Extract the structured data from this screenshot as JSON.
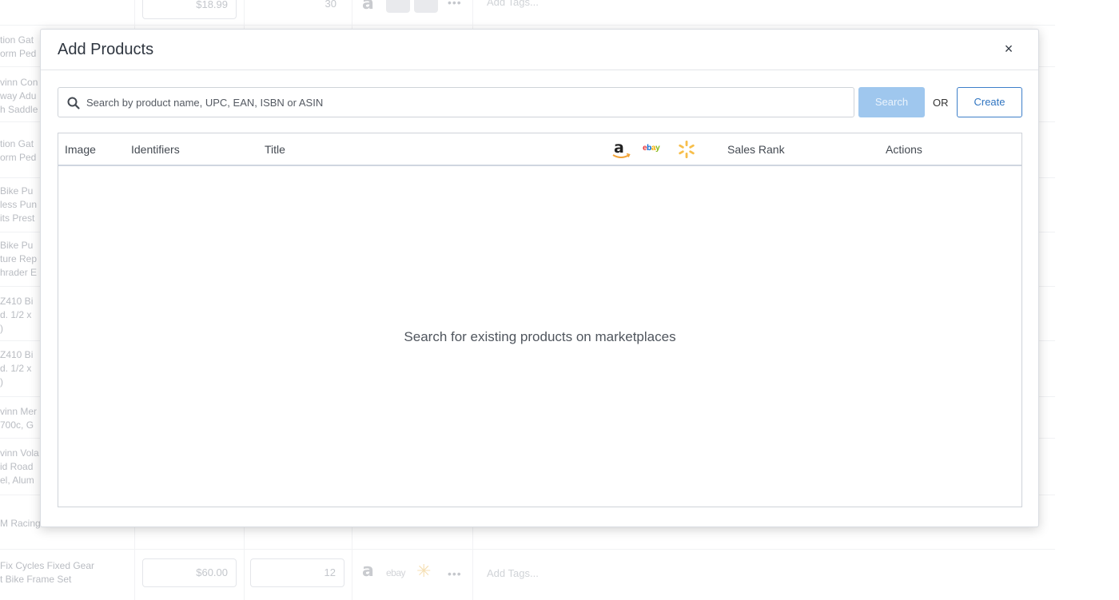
{
  "background": {
    "rows": [
      {
        "name_lines": [],
        "price": "$18.99",
        "qty": "30",
        "tags": "Add Tags..."
      },
      {
        "name_lines": [
          "tion Gat",
          "orm Ped"
        ]
      },
      {
        "name_lines": [
          "vinn Con",
          "way Adu",
          "h Saddle"
        ]
      },
      {
        "name_lines": [
          "tion Gat",
          "orm Ped"
        ]
      },
      {
        "name_lines": [
          "Bike Pu",
          "less Pun",
          "its Prest"
        ]
      },
      {
        "name_lines": [
          "Bike Pu",
          "ture Rep",
          "hrader E"
        ]
      },
      {
        "name_lines": [
          "Z410 Bi",
          "d. 1/2 x",
          ")"
        ]
      },
      {
        "name_lines": [
          "Z410 Bi",
          "d. 1/2 x",
          ")"
        ]
      },
      {
        "name_lines": [
          "vinn Mer",
          "700c, G"
        ]
      },
      {
        "name_lines": [
          "vinn Vola",
          "id Road",
          "el, Alum"
        ]
      },
      {
        "name_lines": [
          "M Racing"
        ]
      },
      {
        "name_lines": [
          "Fix Cycles Fixed Gear",
          "t Bike Frame Set"
        ],
        "price": "$60.00",
        "qty": "12",
        "tags": "Add Tags..."
      }
    ]
  },
  "modal": {
    "title": "Add Products",
    "close_symbol": "×",
    "search": {
      "placeholder": "Search by product name, UPC, EAN, ISBN or ASIN",
      "value": "",
      "button_label": "Search"
    },
    "or_label": "OR",
    "create_label": "Create",
    "table": {
      "columns": {
        "image": "Image",
        "identifiers": "Identifiers",
        "title": "Title",
        "marketplaces": [
          "amazon-icon",
          "ebay-icon",
          "walmart-icon"
        ],
        "ebay_text": "ebay",
        "sales_rank": "Sales Rank",
        "actions": "Actions"
      },
      "empty_message": "Search for existing products on marketplaces"
    }
  },
  "colors": {
    "primary_button_disabled": "#9fc7ee",
    "create_button_border": "#3d7fc9",
    "amazon_orange": "#f1a43a",
    "walmart_yellow": "#f7be4a",
    "ebay_red": "#e53238",
    "ebay_blue": "#0064d2",
    "ebay_yellow": "#f5af02",
    "ebay_green": "#86b817"
  }
}
